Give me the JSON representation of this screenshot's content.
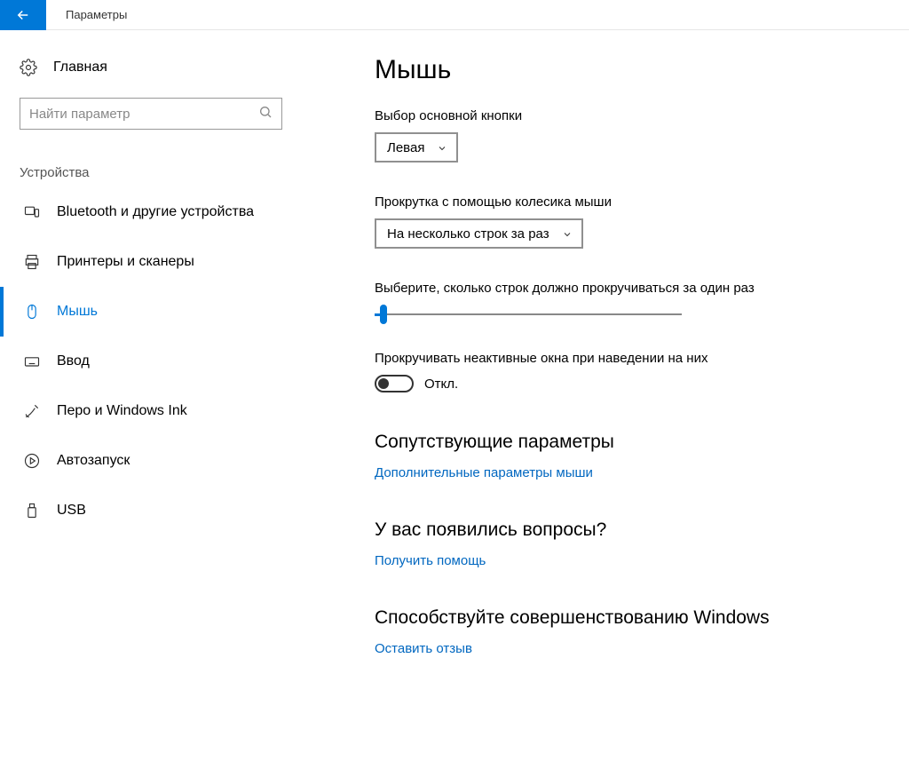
{
  "window": {
    "title": "Параметры"
  },
  "sidebar": {
    "home": "Главная",
    "search_placeholder": "Найти параметр",
    "section": "Устройства",
    "items": [
      {
        "label": "Bluetooth и другие устройства"
      },
      {
        "label": "Принтеры и сканеры"
      },
      {
        "label": "Мышь"
      },
      {
        "label": "Ввод"
      },
      {
        "label": "Перо и Windows Ink"
      },
      {
        "label": "Автозапуск"
      },
      {
        "label": "USB"
      }
    ]
  },
  "main": {
    "title": "Мышь",
    "primary_button_label": "Выбор основной кнопки",
    "primary_button_value": "Левая",
    "scroll_label": "Прокрутка с помощью колесика мыши",
    "scroll_value": "На несколько строк за раз",
    "lines_label": "Выберите, сколько строк должно прокручиваться за один раз",
    "inactive_label": "Прокручивать неактивные окна при наведении на них",
    "inactive_state": "Откл.",
    "related": {
      "heading": "Сопутствующие параметры",
      "link": "Дополнительные параметры мыши"
    },
    "help": {
      "heading": "У вас появились вопросы?",
      "link": "Получить помощь"
    },
    "feedback": {
      "heading": "Способствуйте совершенствованию Windows",
      "link": "Оставить отзыв"
    }
  }
}
